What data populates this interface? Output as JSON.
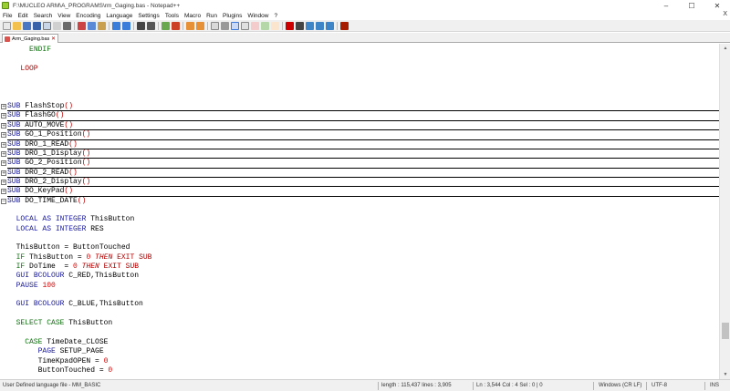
{
  "window": {
    "title": "F:\\MUCLEO ARM\\A_PROGRAMS\\rm_Gaging.bas - Notepad++",
    "controls": [
      "–",
      "☐",
      "✕"
    ]
  },
  "menu": [
    "File",
    "Edit",
    "Search",
    "View",
    "Encoding",
    "Language",
    "Settings",
    "Tools",
    "Macro",
    "Run",
    "Plugins",
    "Window",
    "?"
  ],
  "menu_close": "X",
  "tab": {
    "label": "Arm_Gaging.bas",
    "close": "✕"
  },
  "code_lines": [
    {
      "indent": "     ",
      "parts": [
        {
          "t": "ENDIF",
          "c": "kw-green"
        }
      ]
    },
    {
      "indent": "",
      "parts": []
    },
    {
      "indent": "   ",
      "parts": [
        {
          "t": "LOOP",
          "c": "kw-red-plain"
        }
      ]
    },
    {
      "indent": "",
      "parts": []
    },
    {
      "indent": "",
      "parts": []
    },
    {
      "indent": "",
      "parts": []
    },
    {
      "fold": true,
      "parts": [
        {
          "t": "SUB",
          "c": "kw-blue"
        },
        {
          "t": " FlashStop",
          "c": "plain"
        },
        {
          "t": "()",
          "c": "kw-paren"
        }
      ]
    },
    {
      "fold": true,
      "parts": [
        {
          "t": "SUB",
          "c": "kw-blue"
        },
        {
          "t": " FlashGO",
          "c": "plain"
        },
        {
          "t": "()",
          "c": "kw-paren"
        }
      ]
    },
    {
      "fold": true,
      "parts": [
        {
          "t": "SUB",
          "c": "kw-blue"
        },
        {
          "t": " AUTO_MOVE",
          "c": "plain"
        },
        {
          "t": "()",
          "c": "kw-paren"
        }
      ]
    },
    {
      "fold": true,
      "parts": [
        {
          "t": "SUB",
          "c": "kw-blue"
        },
        {
          "t": " GO_1_Position",
          "c": "plain"
        },
        {
          "t": "()",
          "c": "kw-paren"
        }
      ]
    },
    {
      "fold": true,
      "parts": [
        {
          "t": "SUB",
          "c": "kw-blue"
        },
        {
          "t": " DRO_1_READ",
          "c": "plain"
        },
        {
          "t": "()",
          "c": "kw-paren"
        }
      ]
    },
    {
      "fold": true,
      "parts": [
        {
          "t": "SUB",
          "c": "kw-blue"
        },
        {
          "t": " DRO_1_Display",
          "c": "plain"
        },
        {
          "t": "()",
          "c": "kw-paren"
        }
      ]
    },
    {
      "fold": true,
      "parts": [
        {
          "t": "SUB",
          "c": "kw-blue"
        },
        {
          "t": " GO_2_Position",
          "c": "plain"
        },
        {
          "t": "()",
          "c": "kw-paren"
        }
      ]
    },
    {
      "fold": true,
      "parts": [
        {
          "t": "SUB",
          "c": "kw-blue"
        },
        {
          "t": " DRO_2_READ",
          "c": "plain"
        },
        {
          "t": "()",
          "c": "kw-paren"
        }
      ]
    },
    {
      "fold": true,
      "parts": [
        {
          "t": "SUB",
          "c": "kw-blue"
        },
        {
          "t": " DRO_2_Display",
          "c": "plain"
        },
        {
          "t": "()",
          "c": "kw-paren"
        }
      ]
    },
    {
      "fold": true,
      "parts": [
        {
          "t": "SUB",
          "c": "kw-blue"
        },
        {
          "t": " DO_KeyPad",
          "c": "plain"
        },
        {
          "t": "()",
          "c": "kw-paren"
        }
      ]
    },
    {
      "fold": true,
      "open": true,
      "parts": [
        {
          "t": "SUB",
          "c": "kw-blue"
        },
        {
          "t": " DO_TIME_DATE",
          "c": "plain"
        },
        {
          "t": "()",
          "c": "kw-paren"
        }
      ]
    },
    {
      "indent": "",
      "parts": []
    },
    {
      "indent": "  ",
      "parts": [
        {
          "t": "LOCAL",
          "c": "kw-blue"
        },
        {
          "t": " AS ",
          "c": "kw-blue"
        },
        {
          "t": "INTEGER",
          "c": "kw-blue"
        },
        {
          "t": " ThisButton",
          "c": "plain"
        }
      ]
    },
    {
      "indent": "  ",
      "parts": [
        {
          "t": "LOCAL",
          "c": "kw-blue"
        },
        {
          "t": " AS ",
          "c": "kw-blue"
        },
        {
          "t": "INTEGER",
          "c": "kw-blue"
        },
        {
          "t": " RES",
          "c": "plain"
        }
      ]
    },
    {
      "indent": "",
      "parts": []
    },
    {
      "indent": "  ",
      "parts": [
        {
          "t": "ThisButton = ButtonTouched",
          "c": "plain"
        }
      ]
    },
    {
      "indent": "  ",
      "parts": [
        {
          "t": "IF",
          "c": "kw-green"
        },
        {
          "t": " ThisButton = ",
          "c": "plain"
        },
        {
          "t": "0",
          "c": "num"
        },
        {
          "t": " THEN",
          "c": "kw-red"
        },
        {
          "t": " EXIT SUB",
          "c": "kw-red-plain"
        }
      ]
    },
    {
      "indent": "  ",
      "parts": [
        {
          "t": "IF",
          "c": "kw-green"
        },
        {
          "t": " DoTime  = ",
          "c": "plain"
        },
        {
          "t": "0",
          "c": "num"
        },
        {
          "t": " THEN",
          "c": "kw-red"
        },
        {
          "t": " EXIT SUB",
          "c": "kw-red-plain"
        }
      ]
    },
    {
      "indent": "  ",
      "parts": [
        {
          "t": "GUI BCOLOUR",
          "c": "kw-blue"
        },
        {
          "t": " C_RED,ThisButton",
          "c": "plain"
        }
      ]
    },
    {
      "indent": "  ",
      "parts": [
        {
          "t": "PAUSE",
          "c": "kw-blue"
        },
        {
          "t": " ",
          "c": "plain"
        },
        {
          "t": "100",
          "c": "num"
        }
      ]
    },
    {
      "indent": "",
      "parts": []
    },
    {
      "indent": "  ",
      "parts": [
        {
          "t": "GUI BCOLOUR",
          "c": "kw-blue"
        },
        {
          "t": " C_BLUE,ThisButton",
          "c": "plain"
        }
      ]
    },
    {
      "indent": "",
      "parts": []
    },
    {
      "indent": "  ",
      "parts": [
        {
          "t": "SELECT CASE",
          "c": "kw-green"
        },
        {
          "t": " ThisButton",
          "c": "plain"
        }
      ]
    },
    {
      "indent": "",
      "parts": []
    },
    {
      "indent": "    ",
      "parts": [
        {
          "t": "CASE",
          "c": "kw-green"
        },
        {
          "t": " TimeDate_CLOSE",
          "c": "plain"
        }
      ]
    },
    {
      "indent": "       ",
      "parts": [
        {
          "t": "PAGE",
          "c": "kw-blue"
        },
        {
          "t": " SETUP_PAGE",
          "c": "plain"
        }
      ]
    },
    {
      "indent": "       ",
      "parts": [
        {
          "t": "TimeKpadOPEN = ",
          "c": "plain"
        },
        {
          "t": "0",
          "c": "num"
        }
      ]
    },
    {
      "indent": "       ",
      "parts": [
        {
          "t": "ButtonTouched = ",
          "c": "plain"
        },
        {
          "t": "0",
          "c": "num"
        }
      ]
    }
  ],
  "status": {
    "language": "User Defined language file - MM_BASIC",
    "length": "length : 115,437    lines : 3,905",
    "position": "Ln : 3,544    Col : 4    Sel : 0 | 0",
    "eol": "Windows (CR LF)",
    "encoding": "UTF-8",
    "mode": "INS"
  },
  "colors": {
    "keyword_blue": "#1a1a9e",
    "keyword_green": "#107010",
    "keyword_red": "#b00000",
    "number": "#e00000"
  }
}
